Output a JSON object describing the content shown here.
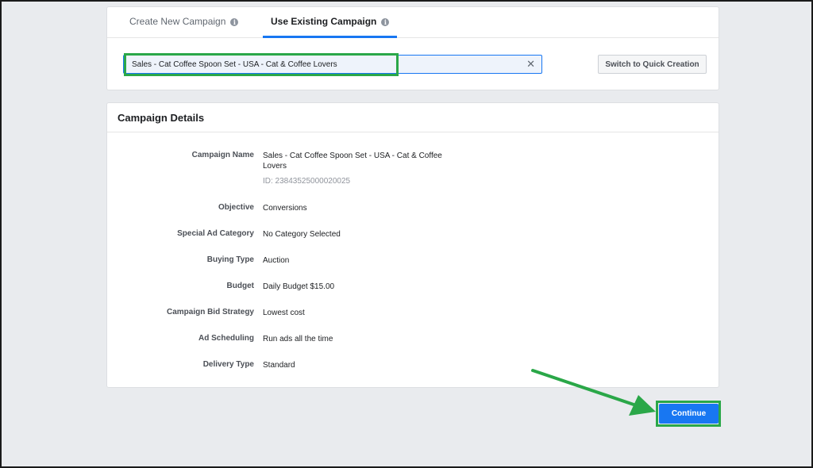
{
  "tabs": {
    "create_label": "Create New Campaign",
    "existing_label": "Use Existing Campaign"
  },
  "search": {
    "value": "Sales - Cat Coffee Spoon Set - USA - Cat & Coffee Lovers"
  },
  "switch_button": "Switch to Quick Creation",
  "details": {
    "title": "Campaign Details",
    "campaign_name_label": "Campaign Name",
    "campaign_name_value": "Sales - Cat Coffee Spoon Set - USA - Cat & Coffee Lovers",
    "campaign_id": "ID: 23843525000020025",
    "objective_label": "Objective",
    "objective_value": "Conversions",
    "special_label": "Special Ad Category",
    "special_value": "No Category Selected",
    "buying_label": "Buying Type",
    "buying_value": "Auction",
    "budget_label": "Budget",
    "budget_value": "Daily Budget $15.00",
    "bid_label": "Campaign Bid Strategy",
    "bid_value": "Lowest cost",
    "scheduling_label": "Ad Scheduling",
    "scheduling_value": "Run ads all the time",
    "delivery_label": "Delivery Type",
    "delivery_value": "Standard"
  },
  "continue_button": "Continue",
  "colors": {
    "accent": "#1877f2",
    "highlight": "#2aa748",
    "background": "#e9ebee"
  },
  "icons": [
    "info-icon",
    "close-icon",
    "arrow-icon"
  ]
}
